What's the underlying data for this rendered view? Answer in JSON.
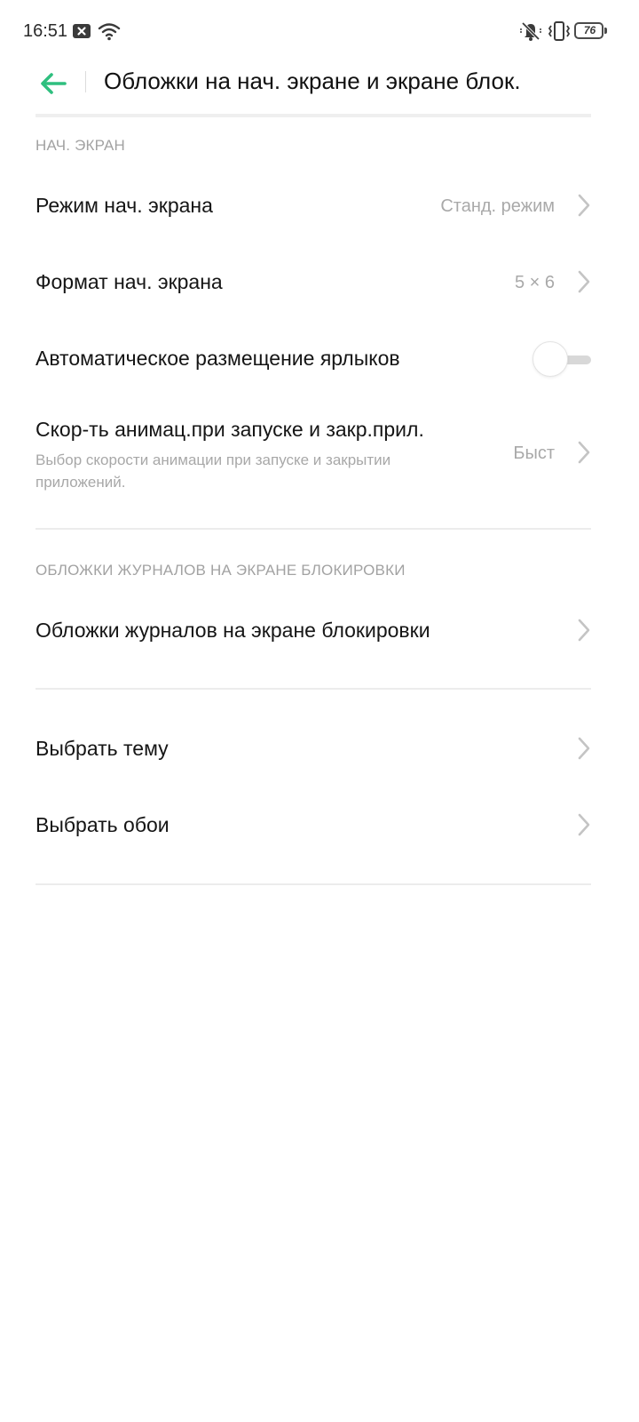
{
  "status_bar": {
    "time": "16:51",
    "battery_level": "76",
    "icons": [
      "notification-x-icon",
      "wifi-icon",
      "mute-icon",
      "vibrate-icon",
      "battery-icon"
    ]
  },
  "header": {
    "title": "Обложки на нач. экране и экране блок.",
    "back_icon": "arrow-left-icon",
    "accent_color": "#2fbf7f"
  },
  "sections": {
    "home": {
      "header": "НАЧ. ЭКРАН",
      "items": [
        {
          "title": "Режим нач. экрана",
          "value": "Станд. режим"
        },
        {
          "title": "Формат нач. экрана",
          "value": "5 × 6"
        },
        {
          "title": "Автоматическое размещение ярлыков",
          "toggle": false
        },
        {
          "title": "Скор-ть анимац.при запуске и закр.прил.",
          "subtitle": "Выбор скорости анимации при запуске и закрытии приложений.",
          "value": "Быст"
        }
      ]
    },
    "lock": {
      "header": "ОБЛОЖКИ ЖУРНАЛОВ НА ЭКРАНЕ БЛОКИРОВКИ",
      "items": [
        {
          "title": "Обложки журналов на экране блокировки"
        }
      ]
    },
    "misc": {
      "items": [
        {
          "title": "Выбрать тему"
        },
        {
          "title": "Выбрать обои"
        }
      ]
    }
  }
}
